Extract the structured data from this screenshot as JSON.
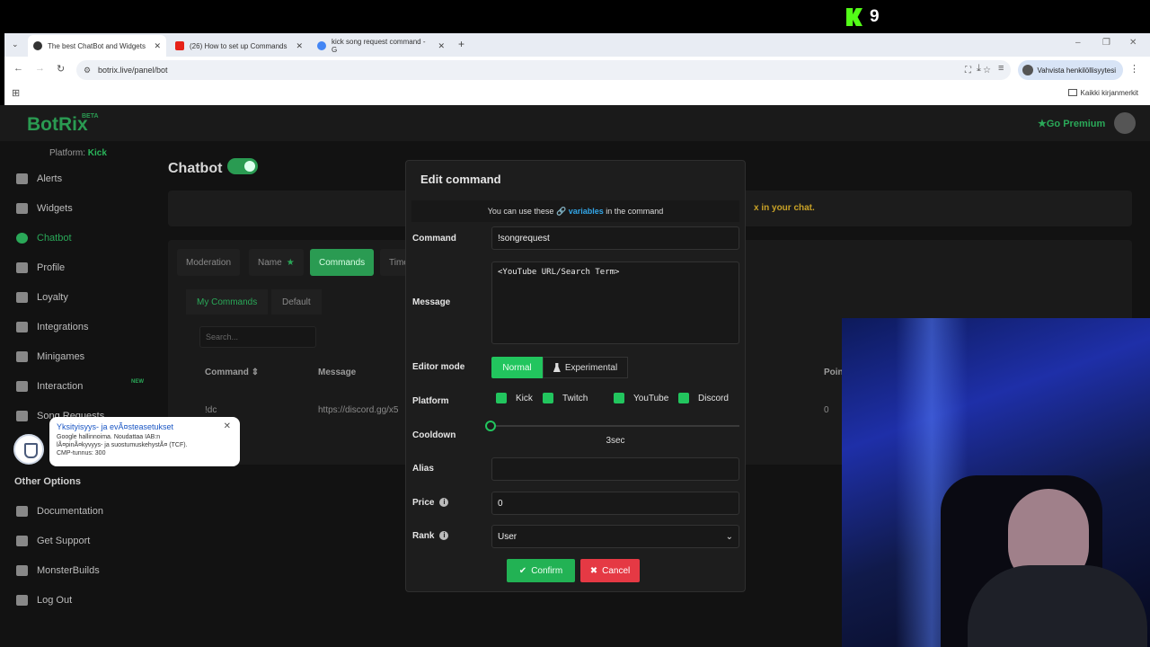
{
  "stream": {
    "viewer_count": "9"
  },
  "browser": {
    "tabs": [
      {
        "title": "The best ChatBot and Widgets"
      },
      {
        "title": "(26) How to set up Commands"
      },
      {
        "title": "kick song request command - G"
      }
    ],
    "url": "botrix.live/panel/bot",
    "profile_label": "Vahvista henkilöllisyytesi",
    "bookmarks_label": "Kaikki kirjanmerkit"
  },
  "app": {
    "logo": "BotRix",
    "logo_badge": "BETA",
    "platform_label": "Platform:",
    "platform_value": "Kick",
    "go_premium": "Go Premium",
    "sidebar": {
      "items": [
        "Alerts",
        "Widgets",
        "Chatbot",
        "Profile",
        "Loyalty",
        "Integrations",
        "Minigames",
        "Interaction",
        "Song Requests"
      ],
      "new_badge": "NEW",
      "other_heading": "Other Options",
      "other_items": [
        "Documentation",
        "Get Support",
        "MonsterBuilds",
        "Log Out"
      ]
    },
    "page_title": "Chatbot",
    "info_text": "x in your chat.",
    "tabs": [
      "Moderation",
      "Name",
      "Commands",
      "Timers"
    ],
    "subtabs": [
      "My Commands",
      "Default"
    ],
    "search_placeholder": "Search...",
    "table": {
      "headers": [
        "Command",
        "Message",
        "Points"
      ],
      "rows": [
        {
          "command": "!dc",
          "message": "https://discord.gg/x5",
          "points": "0"
        }
      ]
    }
  },
  "cookie_popup": {
    "title": "Yksityisyys- ja evÃ¤steasetukset",
    "body_1": "Google hallinnoima. Noudattaa IAB:n",
    "body_2": "lÃ¤pinÃ¤kyvyys- ja suostumuskehystÃ¤ (TCF).",
    "body_3": "CMP-tunnus: 300"
  },
  "modal": {
    "title": "Edit command",
    "vars_prefix": "You can use these",
    "vars_link": "variables",
    "vars_suffix": "in the command",
    "labels": {
      "command": "Command",
      "message": "Message",
      "editor_mode": "Editor mode",
      "platform": "Platform",
      "cooldown": "Cooldown",
      "alias": "Alias",
      "price": "Price",
      "rank": "Rank"
    },
    "command_value": "!songrequest",
    "message_value": "<YouTube URL/Search Term>",
    "editor_modes": {
      "normal": "Normal",
      "experimental": "Experimental",
      "selected": "Normal"
    },
    "platforms": [
      {
        "label": "Kick",
        "checked": true
      },
      {
        "label": "Twitch",
        "checked": true
      },
      {
        "label": "YouTube",
        "checked": true
      },
      {
        "label": "Discord",
        "checked": true
      }
    ],
    "cooldown_value": "3sec",
    "alias_value": "",
    "price_value": "0",
    "rank_value": "User",
    "confirm_label": "Confirm",
    "cancel_label": "Cancel"
  },
  "colors": {
    "accent": "#22c55e",
    "cancel": "#e53944",
    "link": "#33a6e8",
    "kick": "#53fc18"
  }
}
